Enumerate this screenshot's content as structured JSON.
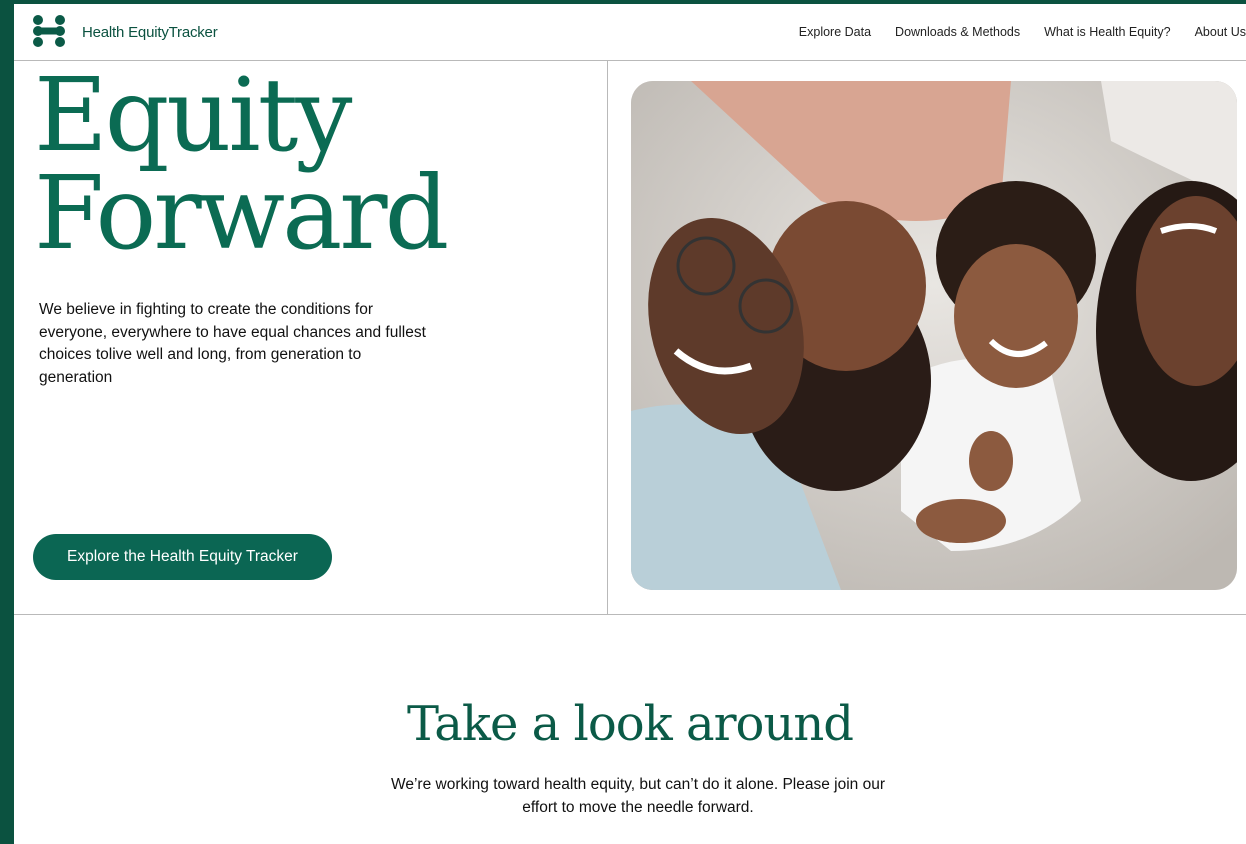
{
  "header": {
    "brand": "Health EquityTracker",
    "nav": [
      {
        "label": "Explore Data"
      },
      {
        "label": "Downloads & Methods"
      },
      {
        "label": "What is Health Equity?"
      },
      {
        "label": "About Us"
      }
    ]
  },
  "hero": {
    "title_line1": "Equity",
    "title_line2": "Forward",
    "description": "We believe in fighting to create the conditions for everyone, everywhere to have equal chances and fullest choices tolive well and long, from generation to generation",
    "cta_label": "Explore the Health Equity Tracker"
  },
  "section": {
    "title": "Take a look around",
    "description": "We’re working toward health equity, but can’t do it alone. Please join our effort to move the needle forward."
  },
  "colors": {
    "brand_green": "#0b6653",
    "frame_green": "#0b5240",
    "title_green": "#0b6b53"
  }
}
